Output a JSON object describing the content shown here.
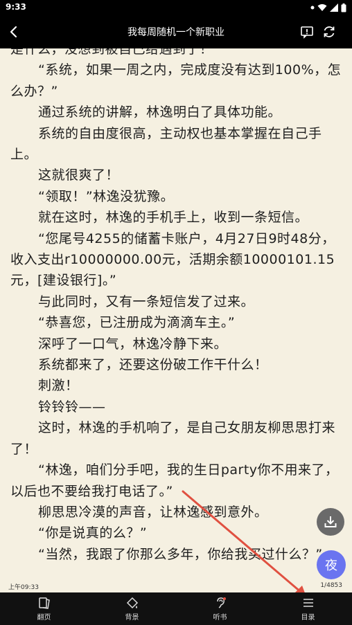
{
  "status_bar": {
    "time": "9:33",
    "icons": [
      "dot-icon",
      "wifi-icon",
      "signal-icon",
      "battery-icon"
    ]
  },
  "top_bar": {
    "title": "我每周随机一个新职业",
    "back_icon": "back-arrow-icon",
    "report_icon": "report-icon",
    "refresh_icon": "refresh-icon"
  },
  "content": {
    "paragraphs": [
      "是什么，没想到被自己给遇到了！",
      "“系统，如果一周之内，完成度没有达到100%，怎么办？”",
      "通过系统的讲解，林逸明白了具体功能。",
      "系统的自由度很高，主动权也基本掌握在自己手上。",
      "这就很爽了！",
      "“领取！”林逸没犹豫。",
      "就在这时，林逸的手机手上，收到一条短信。",
      "“您尾号4255的储蓄卡账户，4月27日9时48分，收入支出r10000000.00元，活期余额10000101.15元，[建设银行]。”",
      "与此同时，又有一条短信发了过来。",
      "“恭喜您，已注册成为滴滴车主。”",
      "深呼了一口气，林逸冷静下来。",
      "系统都来了，还要这份破工作干什么！",
      "刺激！",
      "铃铃铃——",
      "这时，林逸的手机响了，是自己女朋友柳思思打来了！",
      "“林逸，咱们分手吧，我的生日party你不用来了，以后也不要给我打电话了。”",
      "柳思思冷漠的声音，让林逸感到意外。",
      "“你是说真的么？”",
      "“当然，我跟了你那么多年，你给我买过什么？”"
    ]
  },
  "footer": {
    "time": "上午09:33",
    "page": "1/4853"
  },
  "floating": {
    "download_icon": "download-icon",
    "night_label": "夜"
  },
  "bottom_bar": {
    "tabs": [
      {
        "label": "翻页",
        "icon": "page-turn-icon"
      },
      {
        "label": "背景",
        "icon": "background-icon"
      },
      {
        "label": "听书",
        "icon": "listen-icon"
      },
      {
        "label": "目录",
        "icon": "contents-icon"
      }
    ]
  },
  "colors": {
    "background": "#f5f0e1",
    "bar": "#000000",
    "night_button": "#6a74f0",
    "annotation_arrow": "#e05040"
  }
}
